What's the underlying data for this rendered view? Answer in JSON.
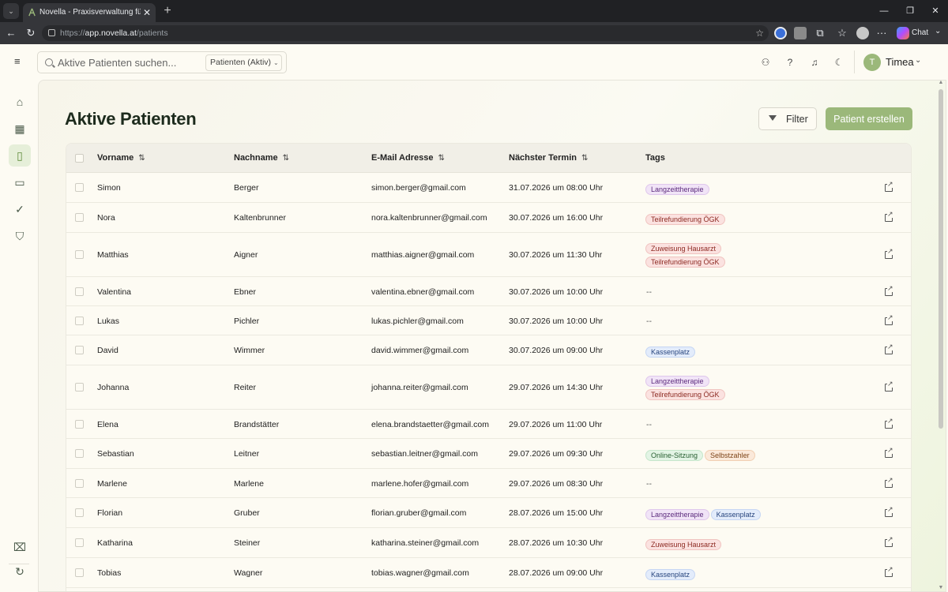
{
  "browser": {
    "tab_title": "Novella - Praxisverwaltung für The",
    "tab_close": "✕",
    "new_tab": "+",
    "url_scheme": "https://",
    "url_host": "app.novella.at",
    "url_path": "/patients",
    "chat_label": "Chat",
    "window_controls": {
      "minimize": "—",
      "maximize": "❐",
      "close": "✕"
    }
  },
  "header": {
    "search_placeholder": "Aktive Patienten suchen...",
    "scope_label": "Patienten (Aktiv)",
    "user_initial": "T",
    "user_name": "Timea"
  },
  "sidebar": {
    "items": [
      {
        "name": "home-icon",
        "glyph": "⌂"
      },
      {
        "name": "calendar-icon",
        "glyph": "▦"
      },
      {
        "name": "book-icon",
        "glyph": "▯"
      },
      {
        "name": "wallet-icon",
        "glyph": "▭"
      },
      {
        "name": "check-circle-icon",
        "glyph": "✓"
      },
      {
        "name": "shield-check-icon",
        "glyph": "⛉"
      }
    ],
    "bottom": [
      {
        "name": "gift-icon",
        "glyph": "⌧"
      },
      {
        "name": "update-icon",
        "glyph": "↻"
      }
    ]
  },
  "page": {
    "title": "Aktive Patienten",
    "filter_label": "Filter",
    "create_label": "Patient erstellen"
  },
  "table": {
    "columns": [
      "Vorname",
      "Nachname",
      "E-Mail Adresse",
      "Nächster Termin",
      "Tags"
    ],
    "sort_glyph": "⇅",
    "empty_tags": "--",
    "rows": [
      {
        "vorname": "Simon",
        "nachname": "Berger",
        "email": "simon.berger@gmail.com",
        "termin": "31.07.2026 um 08:00 Uhr",
        "tags": [
          [
            "Langzeittherapie",
            "purple"
          ]
        ]
      },
      {
        "vorname": "Nora",
        "nachname": "Kaltenbrunner",
        "email": "nora.kaltenbrunner@gmail.com",
        "termin": "30.07.2026 um 16:00 Uhr",
        "tags": [
          [
            "Teilrefundierung ÖGK",
            "red"
          ]
        ]
      },
      {
        "vorname": "Matthias",
        "nachname": "Aigner",
        "email": "matthias.aigner@gmail.com",
        "termin": "30.07.2026 um 11:30 Uhr",
        "tags": [
          [
            "Zuweisung Hausarzt",
            "red"
          ],
          [
            "Teilrefundierung ÖGK",
            "red"
          ]
        ],
        "stack": true
      },
      {
        "vorname": "Valentina",
        "nachname": "Ebner",
        "email": "valentina.ebner@gmail.com",
        "termin": "30.07.2026 um 10:00 Uhr",
        "tags": []
      },
      {
        "vorname": "Lukas",
        "nachname": "Pichler",
        "email": "lukas.pichler@gmail.com",
        "termin": "30.07.2026 um 10:00 Uhr",
        "tags": []
      },
      {
        "vorname": "David",
        "nachname": "Wimmer",
        "email": "david.wimmer@gmail.com",
        "termin": "30.07.2026 um 09:00 Uhr",
        "tags": [
          [
            "Kassenplatz",
            "blue"
          ]
        ]
      },
      {
        "vorname": "Johanna",
        "nachname": "Reiter",
        "email": "johanna.reiter@gmail.com",
        "termin": "29.07.2026 um 14:30 Uhr",
        "tags": [
          [
            "Langzeittherapie",
            "purple"
          ],
          [
            "Teilrefundierung ÖGK",
            "red"
          ]
        ],
        "stack": true
      },
      {
        "vorname": "Elena",
        "nachname": "Brandstätter",
        "email": "elena.brandstaetter@gmail.com",
        "termin": "29.07.2026 um 11:00 Uhr",
        "tags": []
      },
      {
        "vorname": "Sebastian",
        "nachname": "Leitner",
        "email": "sebastian.leitner@gmail.com",
        "termin": "29.07.2026 um 09:30 Uhr",
        "tags": [
          [
            "Online-Sitzung",
            "green"
          ],
          [
            "Selbstzahler",
            "orange"
          ]
        ]
      },
      {
        "vorname": "Marlene",
        "nachname": "Marlene",
        "email": "marlene.hofer@gmail.com",
        "termin": "29.07.2026 um 08:30 Uhr",
        "tags": []
      },
      {
        "vorname": "Florian",
        "nachname": "Gruber",
        "email": "florian.gruber@gmail.com",
        "termin": "28.07.2026 um 15:00 Uhr",
        "tags": [
          [
            "Langzeittherapie",
            "purple"
          ],
          [
            "Kassenplatz",
            "blue"
          ]
        ]
      },
      {
        "vorname": "Katharina",
        "nachname": "Steiner",
        "email": "katharina.steiner@gmail.com",
        "termin": "28.07.2026 um 10:30 Uhr",
        "tags": [
          [
            "Zuweisung Hausarzt",
            "red"
          ]
        ]
      },
      {
        "vorname": "Tobias",
        "nachname": "Wagner",
        "email": "tobias.wagner@gmail.com",
        "termin": "28.07.2026 um 09:00 Uhr",
        "tags": [
          [
            "Kassenplatz",
            "blue"
          ]
        ]
      }
    ]
  },
  "colors": {
    "accent": "#9bb87a",
    "sidebar_active": "#e6efd9",
    "app_bg": "#fdfbf3"
  }
}
